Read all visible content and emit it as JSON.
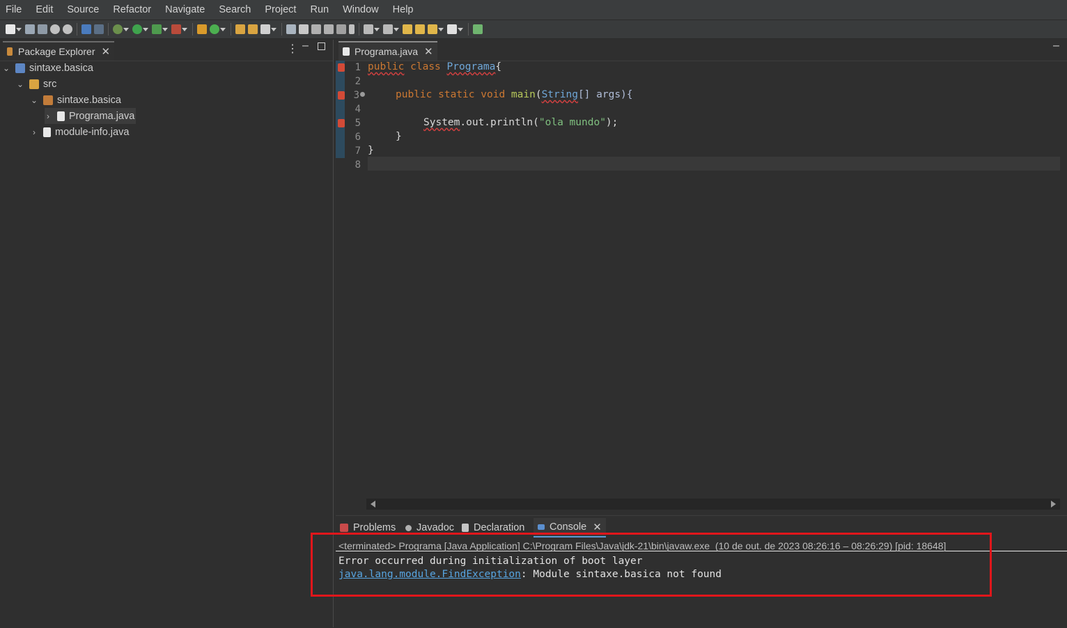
{
  "menu": [
    "File",
    "Edit",
    "Source",
    "Refactor",
    "Navigate",
    "Search",
    "Project",
    "Run",
    "Window",
    "Help"
  ],
  "package_explorer": {
    "title": "Package Explorer",
    "tree": [
      {
        "label": "sintaxe.basica",
        "depth": 0,
        "expanded": true,
        "icon": "project-icon"
      },
      {
        "label": "src",
        "depth": 1,
        "expanded": true,
        "icon": "source-folder-icon"
      },
      {
        "label": "sintaxe.basica",
        "depth": 2,
        "expanded": true,
        "icon": "package-icon"
      },
      {
        "label": "Programa.java",
        "depth": 3,
        "expanded": false,
        "icon": "java-file-icon"
      },
      {
        "label": "module-info.java",
        "depth": 2,
        "expanded": false,
        "icon": "java-file-icon"
      }
    ]
  },
  "editor": {
    "tab_label": "Programa.java",
    "line_numbers": [
      "1",
      "2",
      "3",
      "4",
      "5",
      "6",
      "7",
      "8"
    ],
    "code": {
      "l1_kw1": "public",
      "l1_kw2": "class",
      "l1_name": "Programa",
      "l1_rest": "{",
      "l3_kw1": "public",
      "l3_kw2": "static",
      "l3_kw3": "void",
      "l3_method": "main",
      "l3_open": "(",
      "l3_type": "String",
      "l3_rest": "[] args){",
      "l5_obj": "System",
      "l5_rest": ".out.println(",
      "l5_str": "\"ola mundo\"",
      "l5_end": ");",
      "l6": "}",
      "l7": "}"
    }
  },
  "bottom_tabs": [
    "Problems",
    "Javadoc",
    "Declaration",
    "Console"
  ],
  "console": {
    "header": "<terminated> Programa [Java Application] C:\\Program Files\\Java\\jdk-21\\bin\\javaw.exe  (10 de out. de 2023 08:26:16 – 08:26:29) [pid: 18648]",
    "line1": "Error occurred during initialization of boot layer",
    "exception_link": "java.lang.module.FindException",
    "line2_rest": ": Module sintaxe.basica not found"
  }
}
